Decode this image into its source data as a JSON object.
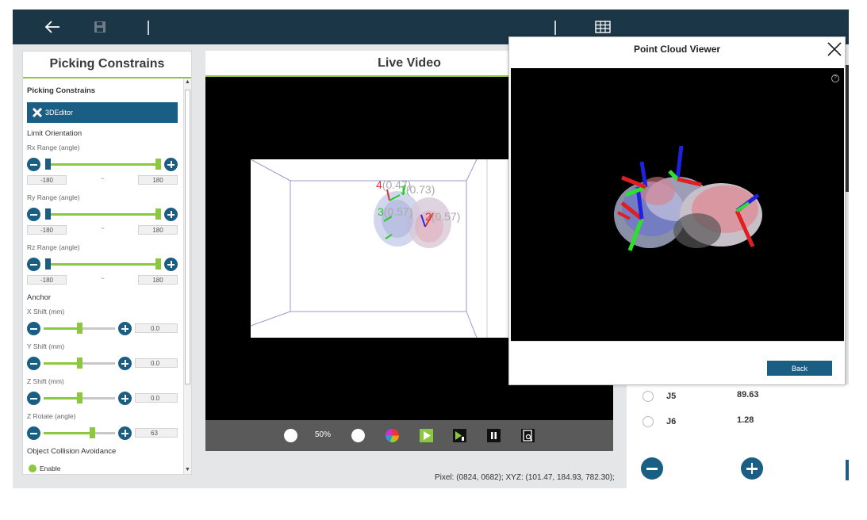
{
  "topbar": {
    "back_icon": "arrow-left-icon",
    "save_icon": "save-icon",
    "grid_icon": "table-grid-icon"
  },
  "left_panel": {
    "title": "Picking Constrains",
    "section_title": "Picking Constrains",
    "editor_button": "3DEditor",
    "limit_orientation": "Limit Orientation",
    "rx_label": "Rx Range (angle)",
    "rx_min": "-180",
    "rx_max": "180",
    "ry_label": "Ry Range (angle)",
    "ry_min": "-180",
    "ry_max": "180",
    "rz_label": "Rz Range (angle)",
    "rz_min": "-180",
    "rz_max": "180",
    "tilde": "~",
    "anchor": "Anchor",
    "x_shift_label": "X Shift (mm)",
    "x_shift_value": "0.0",
    "y_shift_label": "Y Shift (mm)",
    "y_shift_value": "0.0",
    "z_shift_label": "Z Shift (mm)",
    "z_shift_value": "0.0",
    "z_rotate_label": "Z Rotate (angle)",
    "z_rotate_value": "63",
    "collision_label": "Object Collision Avoidance",
    "enable_label": "Enable"
  },
  "video": {
    "title": "Live Video",
    "zoom": "50%",
    "labels": [
      {
        "num": "4",
        "val": "(0.47)"
      },
      {
        "num": "1",
        "val": "(0.73)"
      },
      {
        "num": "3",
        "val": "(0.57)"
      },
      {
        "num": "2",
        "val": "(0.57)"
      }
    ]
  },
  "status": {
    "text": "Pixel:  (0824, 0682); XYZ:  (101.47, 184.93, 782.30);"
  },
  "joints": [
    {
      "name": "J5",
      "value": "89.63"
    },
    {
      "name": "J6",
      "value": "1.28"
    }
  ],
  "dialog": {
    "title": "Point Cloud Viewer",
    "back_label": "Back"
  },
  "colors": {
    "topbar": "#1b3646",
    "accent_blue": "#1b5e84",
    "accent_green": "#8dc63f"
  }
}
